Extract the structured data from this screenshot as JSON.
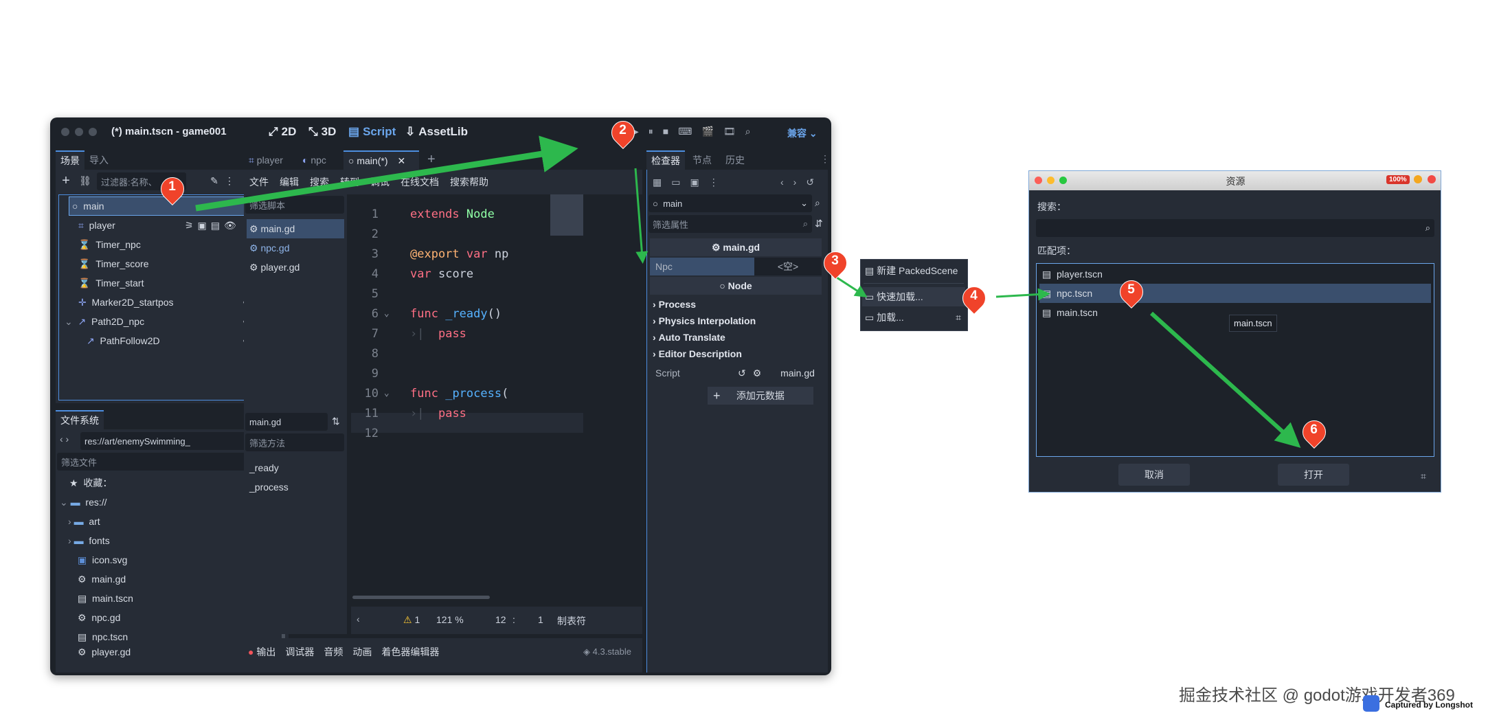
{
  "editor": {
    "title": "(*) main.tscn - game001",
    "top_buttons": [
      "2D",
      "3D",
      "Script",
      "AssetLib"
    ],
    "renderer": "兼容",
    "scene_tabs": [
      "场景",
      "导入"
    ],
    "scene_filter_placeholder": "过滤器:名称、",
    "scene_tree": [
      {
        "name": "main",
        "icon": "node-circle",
        "depth": 0
      },
      {
        "name": "player",
        "icon": "node2d",
        "depth": 1
      },
      {
        "name": "Timer_npc",
        "icon": "hourglass",
        "depth": 1
      },
      {
        "name": "Timer_score",
        "icon": "hourglass",
        "depth": 1
      },
      {
        "name": "Timer_start",
        "icon": "hourglass",
        "depth": 1
      },
      {
        "name": "Marker2D_startpos",
        "icon": "marker",
        "depth": 1
      },
      {
        "name": "Path2D_npc",
        "icon": "path",
        "depth": 1
      },
      {
        "name": "PathFollow2D",
        "icon": "path",
        "depth": 2
      }
    ],
    "filesystem_tab": "文件系统",
    "fs_path": "res://art/enemySwimming_",
    "fs_filter_placeholder": "筛选文件",
    "fs_favorites": "收藏：",
    "fs_items": [
      {
        "name": "res://",
        "kind": "folder"
      },
      {
        "name": "art",
        "kind": "folder"
      },
      {
        "name": "fonts",
        "kind": "folder"
      },
      {
        "name": "icon.svg",
        "kind": "svg"
      },
      {
        "name": "main.gd",
        "kind": "script"
      },
      {
        "name": "main.tscn",
        "kind": "scene"
      },
      {
        "name": "npc.gd",
        "kind": "script"
      },
      {
        "name": "npc.tscn",
        "kind": "scene"
      },
      {
        "name": "player.gd",
        "kind": "script"
      }
    ],
    "script_tabs": [
      "player",
      "npc",
      "main(*)"
    ],
    "script_menu": [
      "文件",
      "编辑",
      "搜索",
      "转到",
      "调试",
      "在线文档",
      "搜索帮助"
    ],
    "script_filter_placeholder": "筛选脚本",
    "script_list": [
      "main.gd",
      "npc.gd",
      "player.gd"
    ],
    "current_script": "main.gd",
    "method_filter_placeholder": "筛选方法",
    "methods": [
      "_ready",
      "_process"
    ],
    "code_lines": [
      {
        "n": "1",
        "text": "extends Node"
      },
      {
        "n": "2",
        "text": ""
      },
      {
        "n": "3",
        "text": "@export var np"
      },
      {
        "n": "4",
        "text": "var score"
      },
      {
        "n": "5",
        "text": ""
      },
      {
        "n": "6",
        "text": "func _ready()"
      },
      {
        "n": "7",
        "text": "pass"
      },
      {
        "n": "8",
        "text": ""
      },
      {
        "n": "9",
        "text": ""
      },
      {
        "n": "10",
        "text": "func _process("
      },
      {
        "n": "11",
        "text": "pass"
      },
      {
        "n": "12",
        "text": ""
      }
    ],
    "status": {
      "warnings": "1",
      "zoom": "121 %",
      "line": "12",
      "col": "1",
      "indent": "制表符"
    },
    "bottom_tabs": [
      "输出",
      "调试器",
      "音频",
      "动画",
      "着色器编辑器"
    ],
    "version": "4.3.stable",
    "inspector_tabs": [
      "检查器",
      "节点",
      "历史"
    ],
    "inspector_node": "main",
    "inspector_filter_placeholder": "筛选属性",
    "inspector_script_header": "main.gd",
    "prop_npc_label": "Npc",
    "prop_npc_value": "<空>",
    "node_section": "Node",
    "sections": [
      "Process",
      "Physics Interpolation",
      "Auto Translate",
      "Editor Description"
    ],
    "script_prop_label": "Script",
    "script_prop_value": "main.gd",
    "add_metadata": "添加元数据"
  },
  "popup_menu": {
    "items": [
      "新建 PackedScene",
      "快速加载...",
      "加载..."
    ]
  },
  "dialog": {
    "title": "资源",
    "zoom_badge": "100%",
    "search_label": "搜索：",
    "matches_label": "匹配项：",
    "matches": [
      "player.tscn",
      "npc.tscn",
      "main.tscn"
    ],
    "tooltip": "main.tscn",
    "cancel": "取消",
    "open": "打开"
  },
  "markers": [
    "1",
    "2",
    "3",
    "4",
    "5",
    "6"
  ],
  "watermark": {
    "text": "掘金技术社区 @ godot游戏开发者369",
    "capture": "Captured by Longshot"
  },
  "colors": {
    "accent": "#4d8ee0",
    "marker": "#f0432a",
    "arrow": "#2db84d"
  }
}
